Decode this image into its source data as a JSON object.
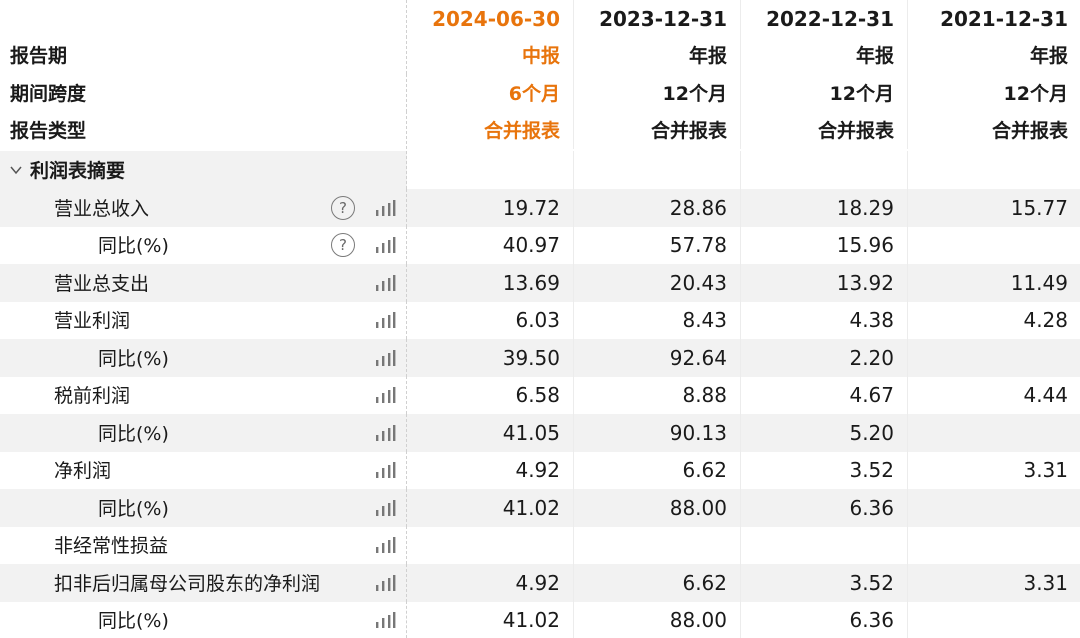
{
  "header": {
    "periods": [
      "2024-06-30",
      "2023-12-31",
      "2022-12-31",
      "2021-12-31"
    ],
    "rows": [
      {
        "label": "报告期",
        "values": [
          "中报",
          "年报",
          "年报",
          "年报"
        ]
      },
      {
        "label": "期间跨度",
        "values": [
          "6个月",
          "12个月",
          "12个月",
          "12个月"
        ]
      },
      {
        "label": "报告类型",
        "values": [
          "合并报表",
          "合并报表",
          "合并报表",
          "合并报表"
        ]
      }
    ]
  },
  "section": {
    "title": "利润表摘要"
  },
  "rows": [
    {
      "label": "营业总收入",
      "values": [
        "19.72",
        "28.86",
        "18.29",
        "15.77"
      ]
    },
    {
      "label": "同比(%)",
      "values": [
        "40.97",
        "57.78",
        "15.96",
        ""
      ]
    },
    {
      "label": "营业总支出",
      "values": [
        "13.69",
        "20.43",
        "13.92",
        "11.49"
      ]
    },
    {
      "label": "营业利润",
      "values": [
        "6.03",
        "8.43",
        "4.38",
        "4.28"
      ]
    },
    {
      "label": "同比(%)",
      "values": [
        "39.50",
        "92.64",
        "2.20",
        ""
      ]
    },
    {
      "label": "税前利润",
      "values": [
        "6.58",
        "8.88",
        "4.67",
        "4.44"
      ]
    },
    {
      "label": "同比(%)",
      "values": [
        "41.05",
        "90.13",
        "5.20",
        ""
      ]
    },
    {
      "label": "净利润",
      "values": [
        "4.92",
        "6.62",
        "3.52",
        "3.31"
      ]
    },
    {
      "label": "同比(%)",
      "values": [
        "41.02",
        "88.00",
        "6.36",
        ""
      ]
    },
    {
      "label": "非经常性损益",
      "values": [
        "",
        "",
        "",
        ""
      ]
    },
    {
      "label": "扣非后归属母公司股东的净利润",
      "values": [
        "4.92",
        "6.62",
        "3.52",
        "3.31"
      ]
    },
    {
      "label": "同比(%)",
      "values": [
        "41.02",
        "88.00",
        "6.36",
        ""
      ]
    }
  ],
  "icons": {
    "help": "question-circle-icon",
    "chart": "bar-chart-icon",
    "collapse": "chevron-down-icon"
  },
  "help_glyph": "?",
  "colors": {
    "accent": "#e8740c",
    "shade": "#f2f2f2"
  }
}
